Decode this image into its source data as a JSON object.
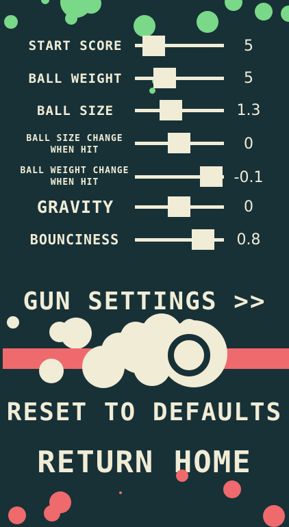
{
  "settings": [
    {
      "label": "START SCORE",
      "value": "5"
    },
    {
      "label": "BALL WEIGHT",
      "value": "5"
    },
    {
      "label": "BALL SIZE",
      "value": "1.3"
    },
    {
      "label": "BALL SIZE CHANGE WHEN HIT",
      "value": "0"
    },
    {
      "label": "BALL WEIGHT CHANGE WHEN HIT",
      "value": "-0.1"
    },
    {
      "label": "GRAVITY",
      "value": "0"
    },
    {
      "label": "BOUNCINESS",
      "value": "0.8"
    }
  ],
  "gun_settings_label": "GUN SETTINGS >>",
  "reset_label": "RESET TO DEFAULTS",
  "return_label": "RETURN HOME",
  "colors": {
    "background": "#173137",
    "cream": "#f1ecd6",
    "green": "#7ad889",
    "pink": "#ee6a6d"
  }
}
